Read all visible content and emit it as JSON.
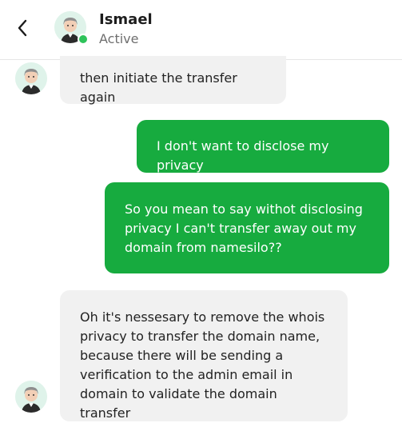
{
  "header": {
    "back_icon": "chevron-left-icon",
    "contact_name": "Ismael",
    "contact_status": "Active",
    "presence_color": "#2ec35a"
  },
  "messages": [
    {
      "direction": "incoming",
      "text": "then initiate the transfer again"
    },
    {
      "direction": "outgoing",
      "text": "I don't want to disclose my privacy"
    },
    {
      "direction": "outgoing",
      "text": "So you mean to say withot disclosing\nprivacy I can't transfer away out my\ndomain from namesilo??"
    },
    {
      "direction": "incoming",
      "text": "Oh it's nessesary to remove the whois\nprivacy to transfer the domain name,\nbecause there will be sending a\nverification to the admin email in\ndomain to validate the domain transfer"
    }
  ],
  "colors": {
    "outgoing_bubble": "#17ab3f",
    "incoming_bubble": "#f1f1f1"
  }
}
